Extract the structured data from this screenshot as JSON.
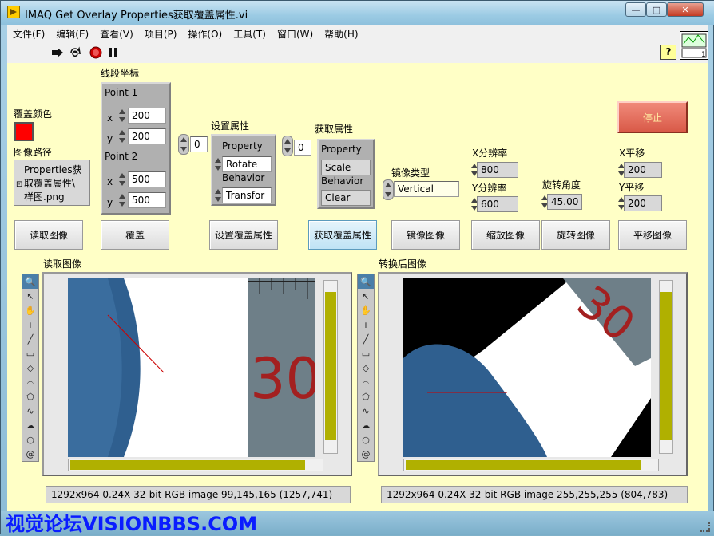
{
  "window": {
    "title": "IMAQ Get Overlay Properties获取覆盖属性.vi",
    "minimize": "—",
    "maximize": "□",
    "close": "✕"
  },
  "menu": [
    "文件(F)",
    "编辑(E)",
    "查看(V)",
    "项目(P)",
    "操作(O)",
    "工具(T)",
    "窗口(W)",
    "帮助(H)"
  ],
  "toolbar": {
    "help": "?"
  },
  "panel": {
    "overlay_color_label": "覆盖颜色",
    "overlay_color": "#ff0000",
    "image_path_label": "图像路径",
    "image_path": [
      "Properties获",
      "取覆盖属性\\",
      "样图.png"
    ],
    "segment_label": "线段坐标",
    "point1_label": "Point 1",
    "point1": {
      "x": "200",
      "y": "200"
    },
    "point2_label": "Point 2",
    "point2": {
      "x": "500",
      "y": "500"
    },
    "x_label": "x",
    "y_label": "y",
    "set_index": "0",
    "set_label": "设置属性",
    "set_props": [
      "Property",
      "Rotate",
      "Behavior",
      "Transfor"
    ],
    "get_index": "0",
    "get_label": "获取属性",
    "get_props": [
      "Property",
      "Scale",
      "Behavior",
      "Clear"
    ],
    "mirror_label": "镜像类型",
    "mirror_value": "Vertical",
    "x_res_label": "X分辨率",
    "x_res": "800",
    "y_res_label": "Y分辨率",
    "y_res": "600",
    "rotate_label": "旋转角度",
    "rotate": "45.00",
    "x_shift_label": "X平移",
    "x_shift": "200",
    "y_shift_label": "Y平移",
    "y_shift": "200",
    "stop": "停止"
  },
  "buttons": {
    "read": "读取图像",
    "overlay": "覆盖",
    "set": "设置覆盖属性",
    "get": "获取覆盖属性",
    "mirror": "镜像图像",
    "scale": "缩放图像",
    "rotate": "旋转图像",
    "shift": "平移图像"
  },
  "display1": {
    "label": "读取图像",
    "status": "1292x964 0.24X 32-bit RGB image 99,145,165     (1257,741)"
  },
  "display2": {
    "label": "转换后图像",
    "status": "1292x964 0.24X 32-bit RGB image 255,255,255     (804,783)"
  },
  "photo": {
    "ruler_number": "30"
  },
  "watermark": "视觉论坛VISIONBBS.COM"
}
